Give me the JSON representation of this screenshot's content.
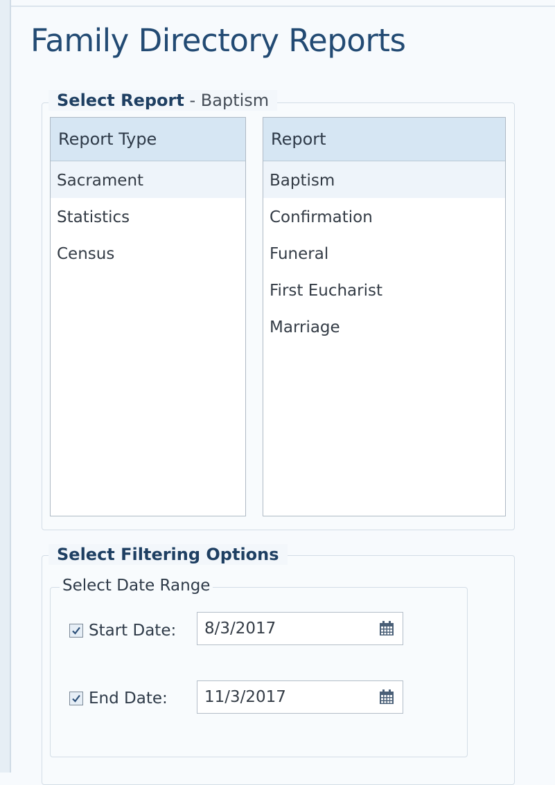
{
  "page": {
    "title": "Family Directory Reports"
  },
  "select_report": {
    "legend_bold": "Select Report",
    "legend_sep": " - ",
    "legend_selected": "Baptism",
    "report_type": {
      "header": "Report Type",
      "items": [
        "Sacrament",
        "Statistics",
        "Census"
      ],
      "selected": "Sacrament"
    },
    "report": {
      "header": "Report",
      "items": [
        "Baptism",
        "Confirmation",
        "Funeral",
        "First Eucharist",
        "Marriage"
      ],
      "selected": "Baptism"
    }
  },
  "filtering": {
    "legend": "Select Filtering Options",
    "date_range": {
      "legend": "Select Date Range",
      "start": {
        "label": "Start Date:",
        "value": "8/3/2017",
        "checked": true
      },
      "end": {
        "label": "End Date:",
        "value": "11/3/2017",
        "checked": true
      }
    }
  },
  "colors": {
    "title": "#224a73",
    "header_bg": "#d6e6f3",
    "selected_row": "#eef4fa",
    "calendar_icon": "#4a5f77"
  },
  "icons": {
    "checkbox": "checkmark-icon",
    "date_picker": "calendar-icon"
  }
}
